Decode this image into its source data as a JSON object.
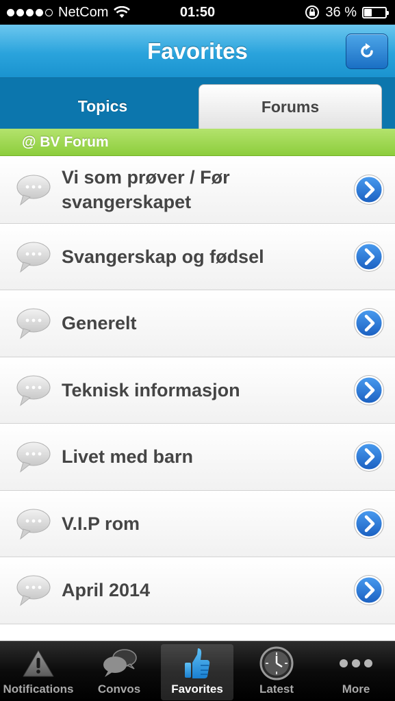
{
  "status": {
    "carrier": "NetCom",
    "time": "01:50",
    "battery": "36 %",
    "battery_level": 0.36
  },
  "nav": {
    "title": "Favorites",
    "refresh_icon": "refresh-icon"
  },
  "tabs": [
    {
      "label": "Topics",
      "selected": false
    },
    {
      "label": "Forums",
      "selected": true
    }
  ],
  "section": {
    "title": "@ BV Forum"
  },
  "forums": [
    {
      "label": "Vi som prøver / Før svangerskapet"
    },
    {
      "label": "Svangerskap og fødsel"
    },
    {
      "label": "Generelt"
    },
    {
      "label": "Teknisk informasjon"
    },
    {
      "label": "Livet med barn"
    },
    {
      "label": "V.I.P rom"
    },
    {
      "label": "April 2014"
    }
  ],
  "tabbar": [
    {
      "label": "Notifications",
      "icon": "warning-icon"
    },
    {
      "label": "Convos",
      "icon": "chat-bubbles-icon"
    },
    {
      "label": "Favorites",
      "icon": "thumbs-up-icon",
      "active": true
    },
    {
      "label": "Latest",
      "icon": "clock-icon"
    },
    {
      "label": "More",
      "icon": "more-dots-icon"
    }
  ],
  "colors": {
    "nav_blue": "#2aa3dc",
    "section_green": "#8ccd3c",
    "chevron_blue": "#1f73d0"
  }
}
